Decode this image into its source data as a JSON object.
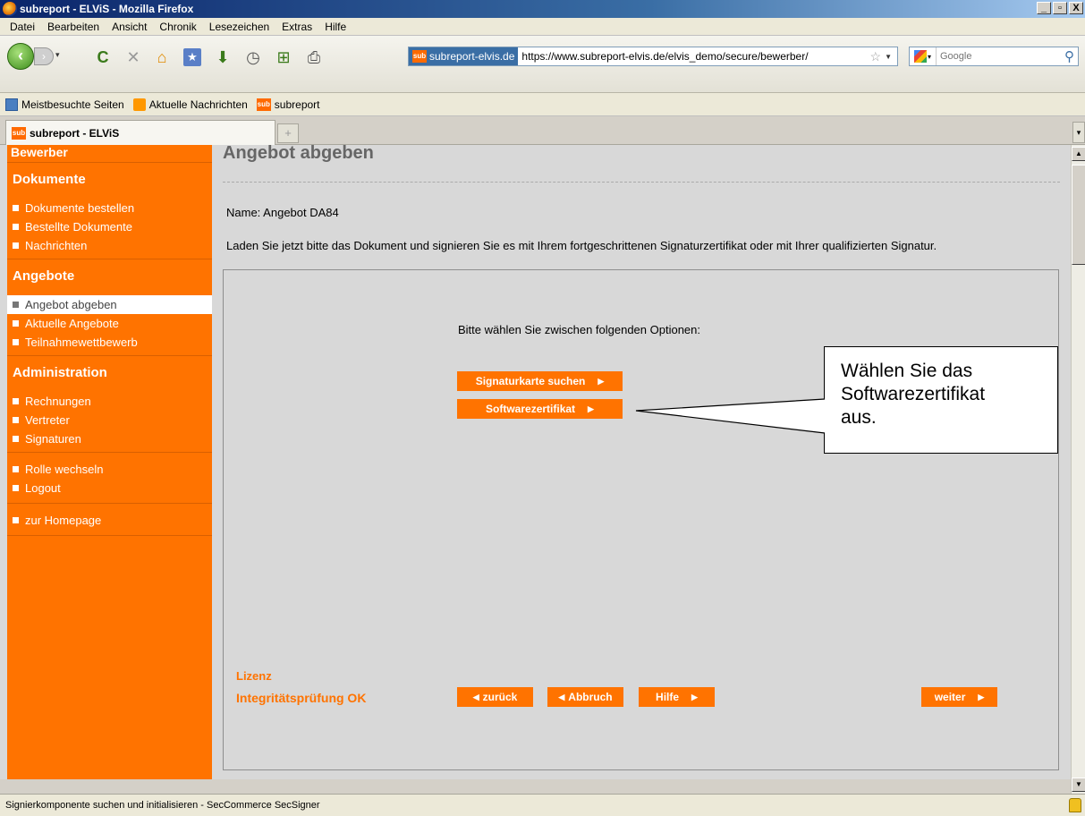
{
  "window": {
    "title": "subreport - ELViS - Mozilla Firefox",
    "buttons": [
      "_",
      "▫",
      "X"
    ]
  },
  "menu": [
    "Datei",
    "Bearbeiten",
    "Ansicht",
    "Chronik",
    "Lesezeichen",
    "Extras",
    "Hilfe"
  ],
  "toolbar": {
    "site_identity": "subreport-elvis.de",
    "url": "https://www.subreport-elvis.de/elvis_demo/secure/bewerber/",
    "search_placeholder": "Google"
  },
  "bookmarks": [
    "Meistbesuchte Seiten",
    "Aktuelle Nachrichten",
    "subreport"
  ],
  "tab": {
    "label": "subreport - ELViS",
    "new_tab_symbol": "+"
  },
  "sub_logo": "sub",
  "sidebar": {
    "top_label": "Bewerber",
    "sections": [
      {
        "title": "Dokumente",
        "items": [
          "Dokumente bestellen",
          "Bestellte Dokumente",
          "Nachrichten"
        ]
      },
      {
        "title": "Angebote",
        "items": [
          "Angebot abgeben",
          "Aktuelle Angebote",
          "Teilnahmewettbewerb"
        ],
        "active_index": 0
      },
      {
        "title": "Administration",
        "items": [
          "Rechnungen",
          "Vertreter",
          "Signaturen"
        ]
      }
    ],
    "extra_groups": [
      [
        "Rolle wechseln",
        "Logout"
      ],
      [
        "zur Homepage"
      ]
    ]
  },
  "main": {
    "title": "Angebot abgeben",
    "name_line": "Name: Angebot DA84",
    "instruction": "Laden Sie jetzt bitte das Dokument und signieren Sie es mit Ihrem fortgeschrittenen Signaturzertifikat oder mit Ihrer qualifizierten Signatur.",
    "choose_text": "Bitte wählen Sie zwischen folgenden Optionen:",
    "option_buttons": [
      "Signaturkarte suchen",
      "Softwarezertifikat"
    ],
    "callout": [
      "Wählen Sie das",
      "Softwarezertifikat",
      "aus."
    ],
    "lizenz": "Lizenz",
    "integrity": "Integritätsprüfung OK",
    "nav_buttons": {
      "back": "zurück",
      "cancel": "Abbruch",
      "help": "Hilfe",
      "next": "weiter"
    }
  },
  "status": "Signierkomponente suchen und initialisieren  - SecCommerce SecSigner",
  "colors": {
    "accent": "#ff7300",
    "titlebar": "#0a246a",
    "content_bg": "#d8d8d8"
  }
}
